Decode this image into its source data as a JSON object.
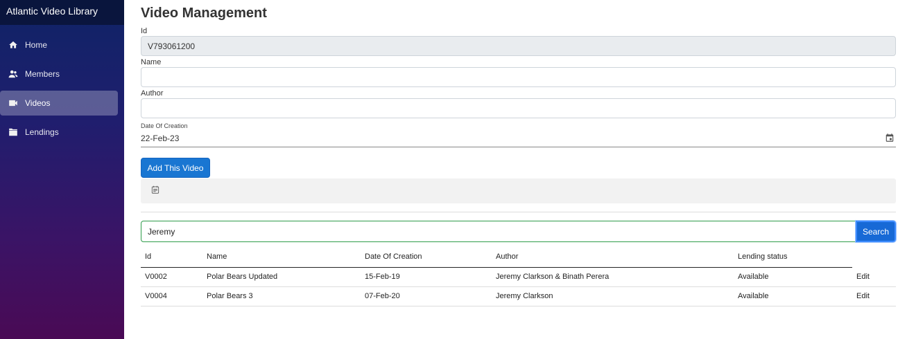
{
  "app": {
    "brand": "Atlantic Video Library"
  },
  "sidebar": {
    "items": [
      {
        "label": "Home",
        "icon": "home-icon",
        "active": false
      },
      {
        "label": "Members",
        "icon": "members-icon",
        "active": false
      },
      {
        "label": "Videos",
        "icon": "video-camera-icon",
        "active": true
      },
      {
        "label": "Lendings",
        "icon": "folder-icon",
        "active": false
      }
    ]
  },
  "form": {
    "title": "Video Management",
    "id_label": "Id",
    "id_value": "V793061200",
    "name_label": "Name",
    "name_value": "",
    "author_label": "Author",
    "author_value": "",
    "date_label": "Date Of Creation",
    "date_value": "22-Feb-23",
    "add_button": "Add This Video"
  },
  "search": {
    "value": "Jeremy",
    "button": "Search"
  },
  "table": {
    "headers": [
      "Id",
      "Name",
      "Date Of Creation",
      "Author",
      "Lending status"
    ],
    "rows": [
      {
        "id": "V0002",
        "name": "Polar Bears Updated",
        "date": "15-Feb-19",
        "author": "Jeremy Clarkson & Binath Perera",
        "status": "Available",
        "action": "Edit"
      },
      {
        "id": "V0004",
        "name": "Polar Bears 3",
        "date": "07-Feb-20",
        "author": "Jeremy Clarkson",
        "status": "Available",
        "action": "Edit"
      }
    ]
  },
  "colors": {
    "primary": "#1976d2",
    "sidebar_top": "#0f2466",
    "sidebar_bottom": "#4a0a55",
    "search_border": "#2e9c4a"
  }
}
